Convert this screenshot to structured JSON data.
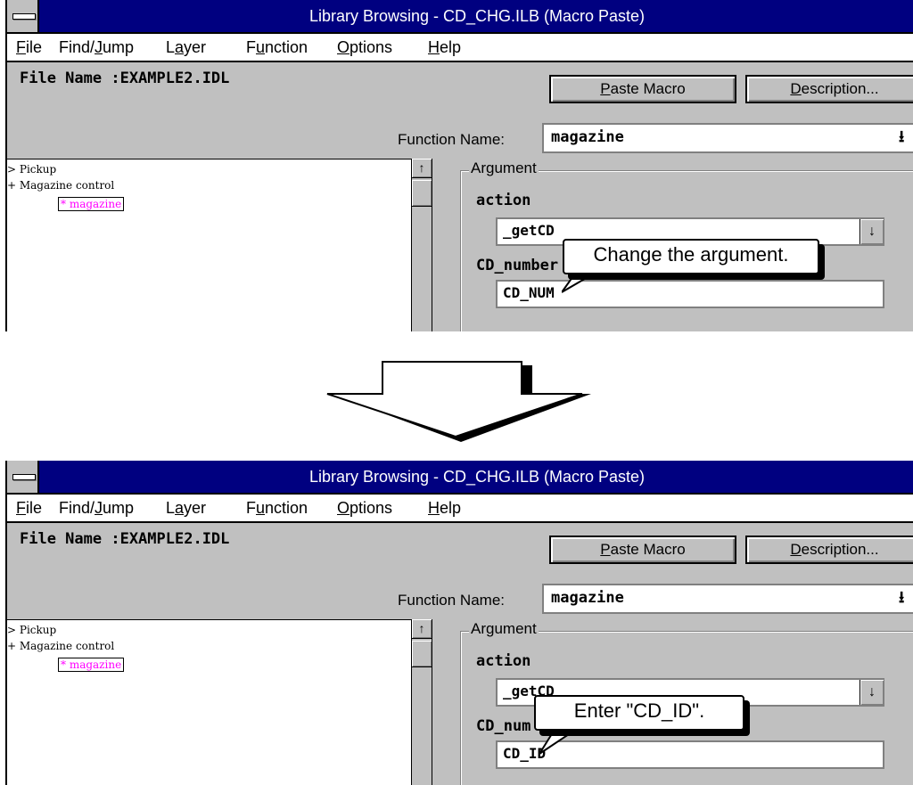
{
  "window": {
    "title": "Library Browsing - CD_CHG.ILB (Macro Paste)",
    "menu": [
      "File",
      "Find/Jump",
      "Layer",
      "Function",
      "Options",
      "Help"
    ],
    "file_name_label": "File Name :EXAMPLE2.IDL",
    "paste_macro_label": "Paste Macro",
    "description_label": "Description...",
    "function_name_label": "Function Name:",
    "function_name_value": "magazine",
    "tree": {
      "items": [
        "> Pickup",
        "+ Magazine control"
      ],
      "selected": "* magazine"
    },
    "argument_group_label": "Argument",
    "action_label": "action",
    "action_value": "_getCD",
    "cd_number_label": "CD_number"
  },
  "top": {
    "cd_number_value": "CD_NUM",
    "callout": "Change the argument."
  },
  "bottom": {
    "cd_number_label_visible": "CD_num",
    "cd_number_value": "CD_ID",
    "callout": "Enter \"CD_ID\"."
  },
  "icons": {
    "scroll_up": "up-arrow-icon",
    "dropdown": "down-arrow-icon",
    "system_menu": "system-menu-icon",
    "transition": "down-arrow-shape"
  }
}
